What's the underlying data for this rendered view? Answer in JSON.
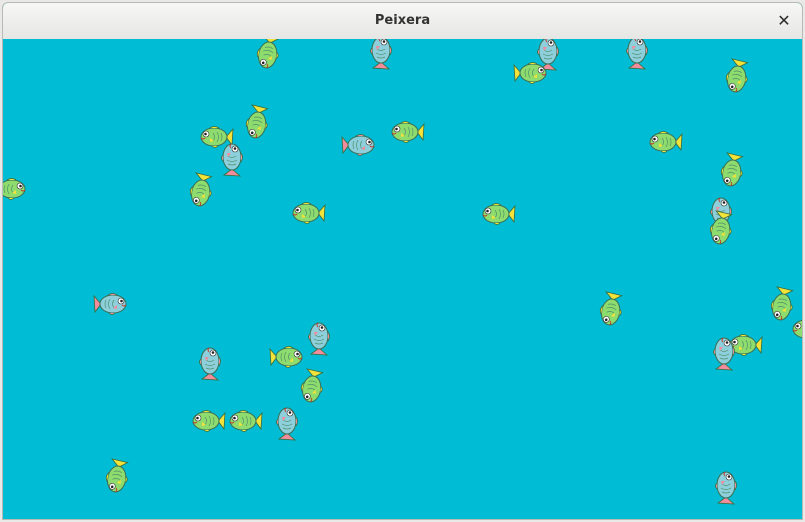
{
  "window": {
    "title": "Peixera",
    "close_glyph": "✕"
  },
  "aquarium": {
    "background_color": "#00bcd4",
    "fish_colors": {
      "green_body": "#8fdc6e",
      "green_fin": "#f2e23a",
      "blue_body": "#8ecfdc",
      "blue_fin": "#f08c9c"
    },
    "fish_kinds": [
      "green",
      "blue"
    ]
  }
}
